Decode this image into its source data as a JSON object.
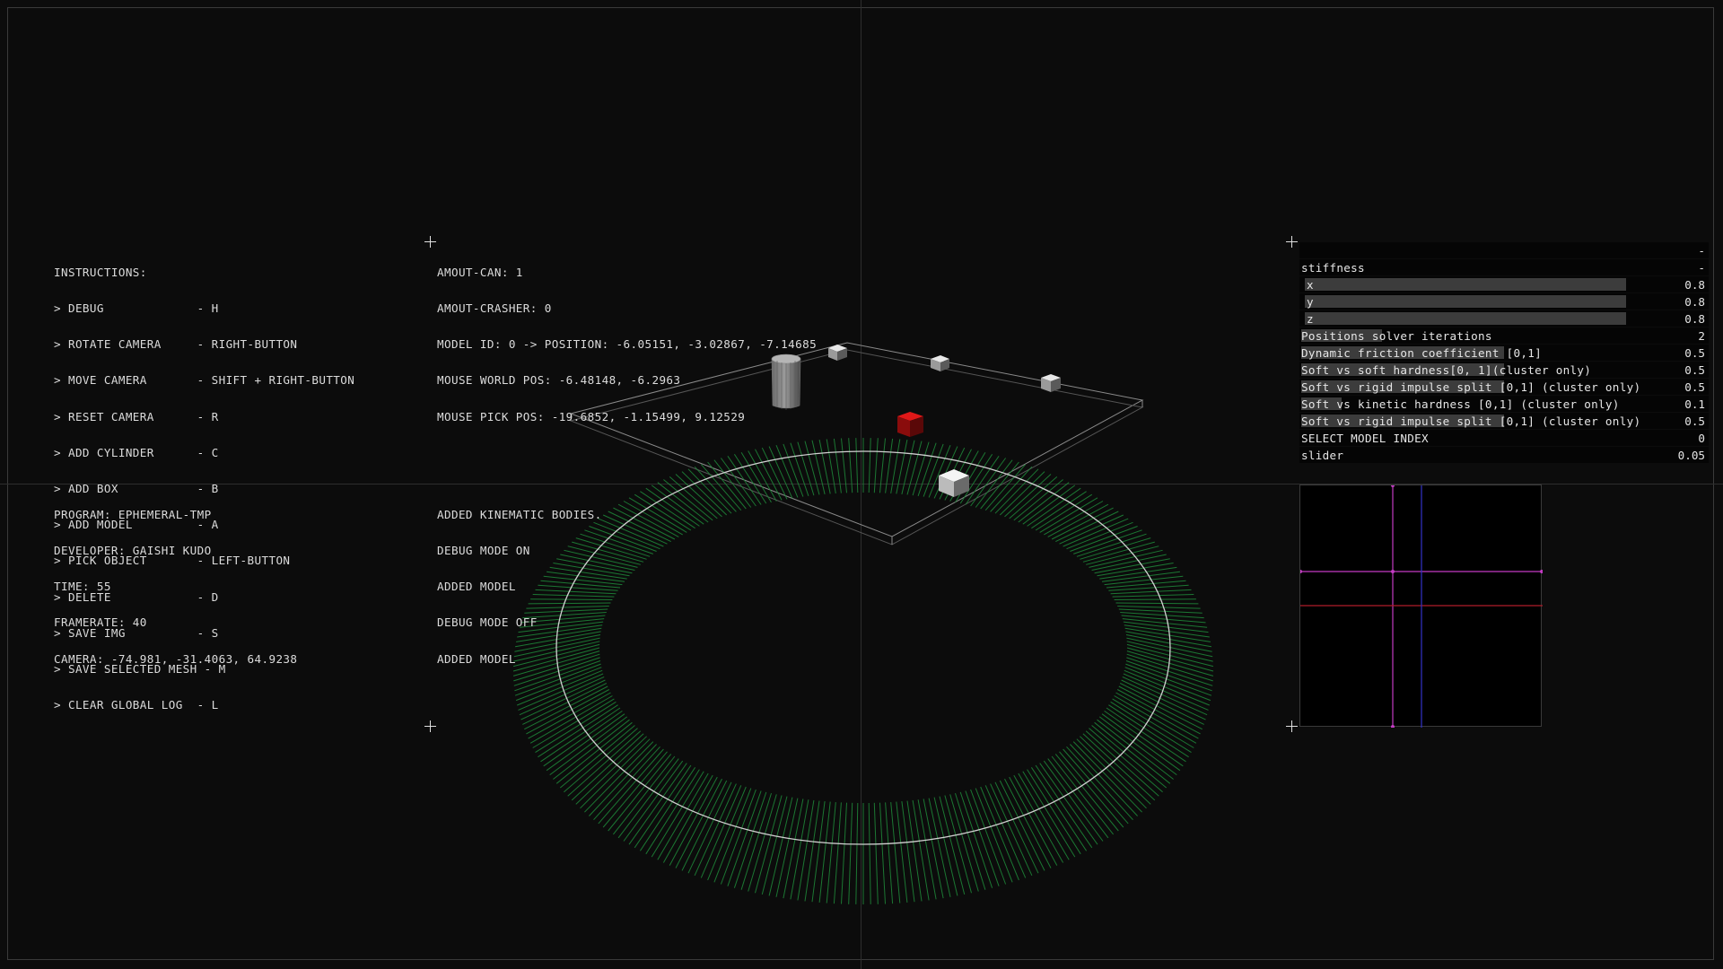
{
  "instructions": [
    "INSTRUCTIONS:",
    "> DEBUG             - H",
    "> ROTATE CAMERA     - RIGHT-BUTTON",
    "> MOVE CAMERA       - SHIFT + RIGHT-BUTTON",
    "> RESET CAMERA      - R",
    "> ADD CYLINDER      - C",
    "> ADD BOX           - B",
    "> ADD MODEL         - A",
    "> PICK OBJECT       - LEFT-BUTTON",
    "> DELETE            - D",
    "> SAVE IMG          - S",
    "> SAVE SELECTED MESH - M",
    "> CLEAR GLOBAL LOG  - L"
  ],
  "info": [
    "AMOUT-CAN: 1",
    "AMOUT-CRASHER: 0",
    "MODEL ID: 0 -> POSITION: -6.05151, -3.02867, -7.14685",
    "MOUSE WORLD POS: -6.48148, -6.2963",
    "MOUSE PICK POS: -19.6852, -1.15499, 9.12529"
  ],
  "program_info": [
    "PROGRAM: EPHEMERAL-TMP",
    "DEVELOPER: GAISHI KUDO",
    "TIME: 55",
    "FRAMERATE: 40",
    "CAMERA: -74.981, -31.4063, 64.9238"
  ],
  "log": [
    "ADDED KINEMATIC BODIES.",
    "DEBUG MODE ON",
    "ADDED MODEL",
    "DEBUG MODE OFF",
    "ADDED MODEL"
  ],
  "gui": {
    "header_toggle": "-",
    "stiffness": {
      "label": "stiffness",
      "toggle": "-"
    },
    "x": {
      "label": "x",
      "value": "0.8",
      "fill": 0.8
    },
    "y": {
      "label": "y",
      "value": "0.8",
      "fill": 0.8
    },
    "z": {
      "label": "z",
      "value": "0.8",
      "fill": 0.8
    },
    "iterations": {
      "label": "Positions solver iterations",
      "value": "2",
      "fill": 0.2
    },
    "friction": {
      "label": "Dynamic friction coefficient [0,1]",
      "value": "0.5",
      "fill": 0.5
    },
    "soft_soft": {
      "label": "Soft vs soft hardness[0, 1](cluster only)",
      "value": "0.5",
      "fill": 0.5
    },
    "soft_rigid_1": {
      "label": "Soft vs rigid impulse split [0,1] (cluster only)",
      "value": "0.5",
      "fill": 0.5
    },
    "soft_kinetic": {
      "label": "Soft vs kinetic hardness [0,1] (cluster only)",
      "value": "0.1",
      "fill": 0.1
    },
    "soft_rigid_2": {
      "label": "Soft vs rigid impulse split [0,1] (cluster only)",
      "value": "0.5",
      "fill": 0.5
    },
    "model_index": {
      "label": "SELECT MODEL INDEX",
      "value": "0"
    },
    "slider": {
      "label": "slider",
      "value": "0.05"
    }
  },
  "colors": {
    "background": "#0c0c0c",
    "ring": "#1f8a3a",
    "selected_box": "#c41212",
    "minimap_magenta": "#c23bc2",
    "minimap_red": "#b01c2a",
    "minimap_blue": "#3232c8"
  }
}
